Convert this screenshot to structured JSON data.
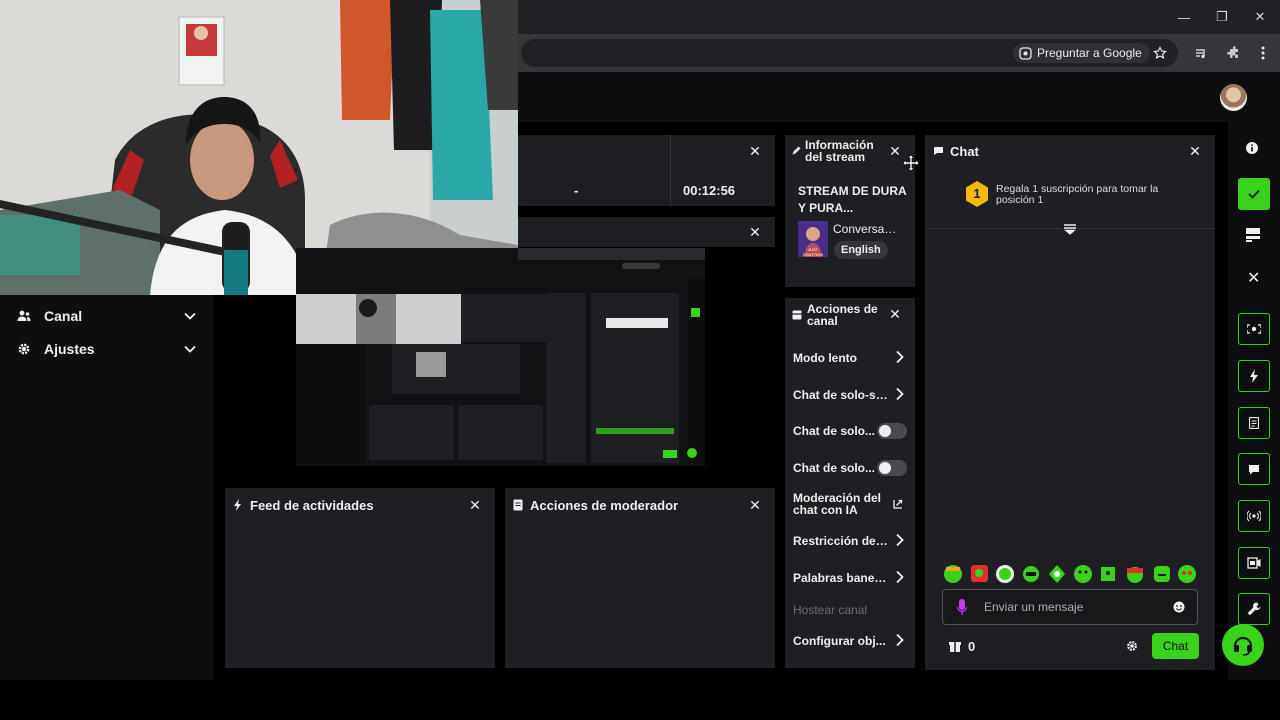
{
  "browser": {
    "ask_google": "Preguntar a Google"
  },
  "sidebar": {
    "items": [
      {
        "label": "Canal"
      },
      {
        "label": "Ajustes"
      }
    ]
  },
  "stats": {
    "value_dash": "-",
    "timer": "00:12:56"
  },
  "stream_info": {
    "title": "Información del stream",
    "stream_title": "STREAM DE DURA Y PURA...",
    "category": "Conversando",
    "tag": "English",
    "thumb_text": "JUST CHATTING"
  },
  "channel_actions": {
    "title": "Acciones de canal",
    "items": [
      {
        "label": "Modo lento"
      },
      {
        "label": "Chat de solo-seg"
      },
      {
        "label": "Chat de solo..."
      },
      {
        "label": "Chat de solo..."
      },
      {
        "label": "Moderación del chat con IA"
      },
      {
        "label": "Restricción de ed"
      },
      {
        "label": "Palabras baneadas"
      },
      {
        "label": "Hostear canal"
      },
      {
        "label": "Configurar obj..."
      }
    ]
  },
  "activity_feed": {
    "title": "Feed de actividades"
  },
  "mod_actions": {
    "title": "Acciones de moderador"
  },
  "chat": {
    "title": "Chat",
    "rank": "1",
    "gift_text": "Regala 1 suscripción para tomar la posición 1",
    "input_placeholder": "Enviar un mensaje",
    "points": "0",
    "send_label": "Chat"
  },
  "colors": {
    "accent": "#39d31b",
    "panel": "#1f1f23",
    "background": "#0e0e10"
  }
}
